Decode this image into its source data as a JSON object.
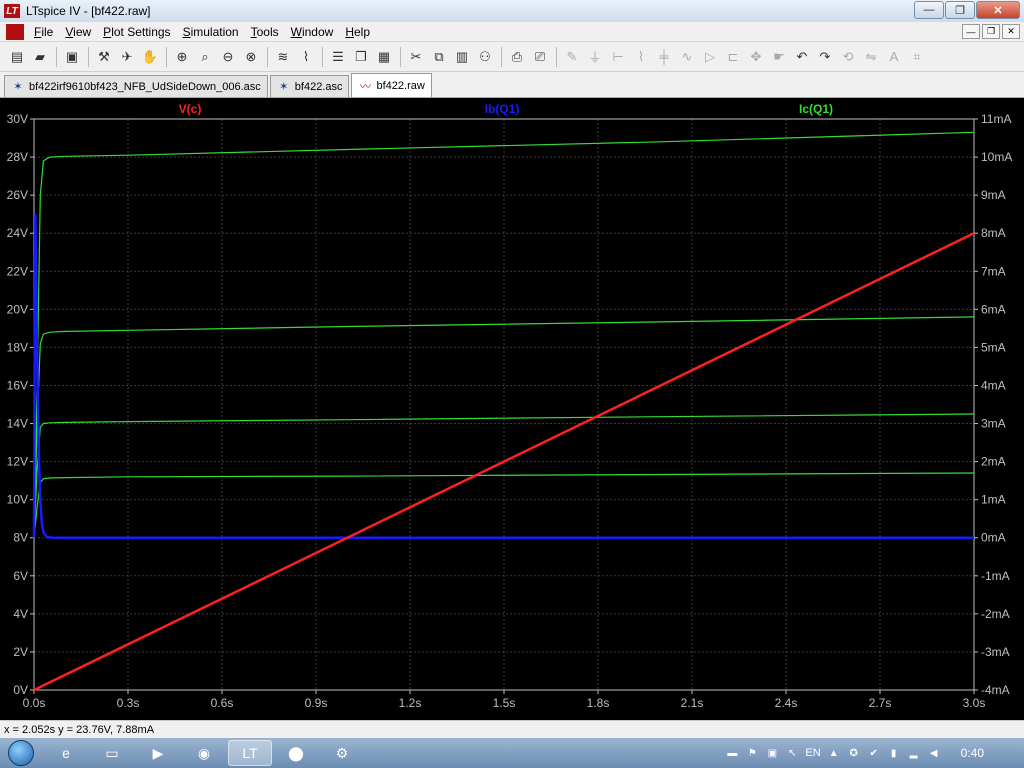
{
  "window": {
    "title": "LTspice IV - [bf422.raw]"
  },
  "window_controls": {
    "minimize": "—",
    "maximize": "❐",
    "close": "✕"
  },
  "menu": {
    "items": [
      {
        "first": "F",
        "rest": "ile"
      },
      {
        "first": "V",
        "rest": "iew"
      },
      {
        "first": "P",
        "rest": "lot Settings"
      },
      {
        "first": "S",
        "rest": "imulation"
      },
      {
        "first": "T",
        "rest": "ools"
      },
      {
        "first": "W",
        "rest": "indow"
      },
      {
        "first": "H",
        "rest": "elp"
      }
    ]
  },
  "tabs": [
    {
      "label": "bf422irf9610bf423_NFB_UdSideDown_006.asc",
      "icon": "schematic-icon",
      "active": false
    },
    {
      "label": "bf422.asc",
      "icon": "schematic-icon",
      "active": false
    },
    {
      "label": "bf422.raw",
      "icon": "waveform-icon",
      "active": true
    }
  ],
  "status": {
    "cursor": "x = 2.052s    y = 23.76V, 7.88mA"
  },
  "taskbar": {
    "language": "EN",
    "clock": "0:40"
  },
  "colors": {
    "vc": "#ff2020",
    "ib": "#1a1aff",
    "ic": "#33dd33",
    "grid": "#3a3a3a",
    "axis": "#bfbfbf"
  },
  "chart_data": {
    "type": "line",
    "traces": [
      {
        "name": "V(c)",
        "color": "#ff2020",
        "axis": "left"
      },
      {
        "name": "Ib(Q1)",
        "color": "#1a1aff",
        "axis": "right"
      },
      {
        "name": "Ic(Q1)",
        "color": "#33dd33",
        "axis": "right"
      }
    ],
    "x_ticks": [
      "0.0s",
      "0.3s",
      "0.6s",
      "0.9s",
      "1.2s",
      "1.5s",
      "1.8s",
      "2.1s",
      "2.4s",
      "2.7s",
      "3.0s"
    ],
    "y_left_ticks": [
      "0V",
      "2V",
      "4V",
      "6V",
      "8V",
      "10V",
      "12V",
      "14V",
      "16V",
      "18V",
      "20V",
      "22V",
      "24V",
      "26V",
      "28V",
      "30V"
    ],
    "y_right_ticks": [
      "-4mA",
      "-3mA",
      "-2mA",
      "-1mA",
      "0mA",
      "1mA",
      "2mA",
      "3mA",
      "4mA",
      "5mA",
      "6mA",
      "7mA",
      "8mA",
      "9mA",
      "10mA",
      "11mA"
    ],
    "xlim": [
      0,
      3
    ],
    "ylim_left": [
      0,
      30
    ],
    "ylim_right": [
      -4,
      11
    ],
    "series": {
      "vc": {
        "x": [
          0,
          3
        ],
        "y": [
          0,
          24
        ]
      },
      "ib": {
        "x": [
          0,
          0.004,
          0.008,
          0.012,
          0.016,
          0.02,
          0.025,
          0.03,
          0.04,
          0.06,
          3
        ],
        "y": [
          0,
          8.5,
          5.8,
          3.8,
          2.0,
          1.0,
          0.4,
          0.15,
          0.02,
          0,
          0
        ]
      },
      "ic": [
        {
          "x": [
            0,
            0.01,
            0.02,
            0.03,
            0.05,
            0.1,
            0.3,
            1.0,
            2.0,
            3.0
          ],
          "y": [
            0,
            4,
            9.0,
            9.9,
            10.0,
            10.02,
            10.05,
            10.2,
            10.4,
            10.65
          ]
        },
        {
          "x": [
            0,
            0.01,
            0.02,
            0.03,
            0.05,
            0.1,
            0.3,
            1.0,
            2.0,
            3.0
          ],
          "y": [
            0,
            3,
            5.1,
            5.35,
            5.4,
            5.42,
            5.45,
            5.55,
            5.67,
            5.8
          ]
        },
        {
          "x": [
            0,
            0.01,
            0.02,
            0.03,
            0.05,
            0.1,
            0.3,
            1.0,
            2.0,
            3.0
          ],
          "y": [
            0,
            1.8,
            2.9,
            3.0,
            3.02,
            3.03,
            3.05,
            3.1,
            3.18,
            3.25
          ]
        },
        {
          "x": [
            0,
            0.01,
            0.02,
            0.03,
            0.05,
            0.1,
            0.3,
            1.0,
            2.0,
            3.0
          ],
          "y": [
            0,
            0.8,
            1.45,
            1.55,
            1.57,
            1.58,
            1.6,
            1.62,
            1.66,
            1.7
          ]
        }
      ]
    },
    "grid": true
  }
}
